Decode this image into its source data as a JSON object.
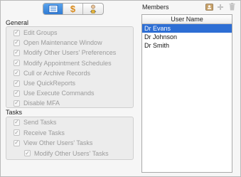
{
  "toolbar": {
    "tabs": [
      {
        "icon": "list-icon",
        "active": true
      },
      {
        "icon": "dollar-icon",
        "active": false
      },
      {
        "icon": "user-lock-icon",
        "active": false
      }
    ],
    "dollar_glyph": "$"
  },
  "general": {
    "title": "General",
    "items": [
      {
        "label": "Edit Groups",
        "checked": true
      },
      {
        "label": "Open Maintenance Window",
        "checked": true
      },
      {
        "label": "Modify Other Users' Preferences",
        "checked": true
      },
      {
        "label": "Modify Appointment Schedules",
        "checked": true
      },
      {
        "label": "Cull or Archive Records",
        "checked": true
      },
      {
        "label": "Use QuickReports",
        "checked": true
      },
      {
        "label": "Use Execute Commands",
        "checked": true
      },
      {
        "label": "Disable MFA",
        "checked": true
      }
    ]
  },
  "tasks": {
    "title": "Tasks",
    "items": [
      {
        "label": "Send Tasks",
        "checked": true
      },
      {
        "label": "Receive Tasks",
        "checked": true
      },
      {
        "label": "View Other Users' Tasks",
        "checked": true
      },
      {
        "label": "Modify Other Users' Tasks",
        "checked": true
      }
    ]
  },
  "members": {
    "title": "Members",
    "column_header": "User Name",
    "rows": [
      "Dr Evans",
      "Dr Johnson",
      "Dr Smith"
    ],
    "selected_index": 0
  },
  "colors": {
    "selection": "#2d6ed4",
    "segment_active": "#3a86dc",
    "dollar": "#d98a1a"
  }
}
